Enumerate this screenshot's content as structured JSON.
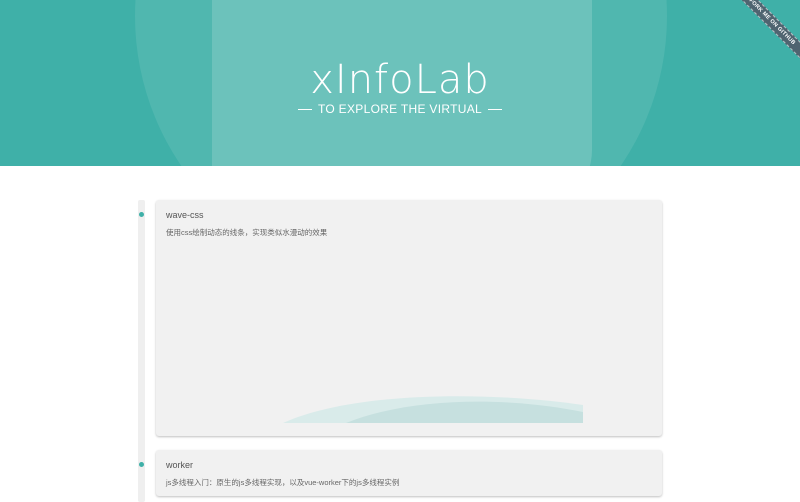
{
  "hero": {
    "logo_text": "xInfoLab",
    "tagline": "TO EXPLORE THE VIRTUAL"
  },
  "ribbon": {
    "label": "FORK ME ON GITHUB"
  },
  "colors": {
    "accent": "#3fb0a8",
    "card_bg": "#f1f1f1",
    "ribbon": "#4f6470"
  },
  "projects": [
    {
      "title": "wave-css",
      "description": "使用css绘制动态的线条，实现类似水漫动的效果"
    },
    {
      "title": "worker",
      "description": "js多线程入门：原生的js多线程实现，以及vue-worker下的js多线程实例"
    }
  ]
}
